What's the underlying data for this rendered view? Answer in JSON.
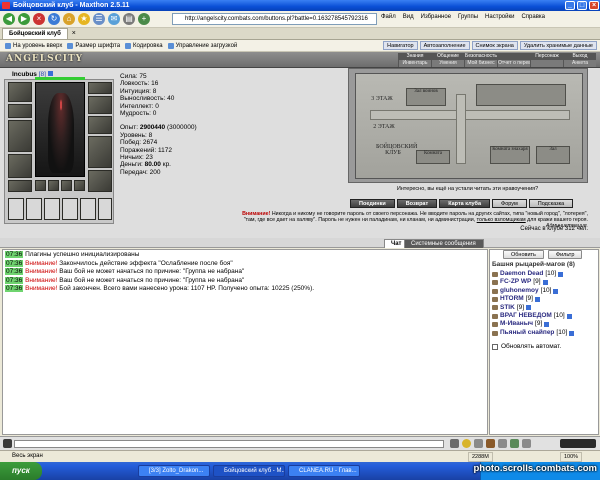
{
  "window": {
    "title": "Бойцовский клуб - Maxthon 2.5.11"
  },
  "browser": {
    "address": "http://angelscity.combats.com/buttons.pl?battle=0.163278545792316",
    "menus": [
      "Файл",
      "Вид",
      "Избранное",
      "Группы",
      "Настройки",
      "Справка"
    ],
    "tabs": [
      {
        "label": "Бойцовский клуб",
        "active": true
      }
    ],
    "toolbar": [
      "На уровень вверх",
      "Размер шрифта",
      "Кодировка",
      "Управление загрузкой"
    ],
    "toolbar_right": [
      "Навигатор",
      "Автозаполнение",
      "Снимок экрана",
      "Удалить хранимые данные"
    ]
  },
  "game": {
    "logo": "ANGELSCITY",
    "menu_top": [
      "Знания",
      "Общение",
      "Безопасность",
      "Персонаж",
      "Выход"
    ],
    "menu_bottom": [
      "Инвентарь",
      "Умения",
      "Мой бизнес",
      "Отчет о переводах",
      "Анкета"
    ],
    "character": {
      "name": "Incubus",
      "level": "[8]",
      "stats": [
        {
          "label": "Сила",
          "value": "75"
        },
        {
          "label": "Ловкость",
          "value": "16"
        },
        {
          "label": "Интуиция",
          "value": "8"
        },
        {
          "label": "Выносливость",
          "value": "40"
        },
        {
          "label": "Интеллект",
          "value": "0"
        },
        {
          "label": "Мудрость",
          "value": "0"
        }
      ],
      "experience_label": "Опыт:",
      "experience": "2900440",
      "experience_next": "(3000000)",
      "level_label": "Уровень:",
      "level_value": "8",
      "wins_label": "Побед:",
      "wins": "2674",
      "losses_label": "Поражений:",
      "losses": "1172",
      "draws_label": "Ничьих:",
      "draws": "23",
      "money_label": "Деньги:",
      "money": "80.00",
      "money_unit": "кр.",
      "transfers_label": "Передач:",
      "transfers": "200"
    },
    "map": {
      "rooms": [
        "3 ЭТАЖ",
        "Зал воинов",
        "2 ЭТАЖ",
        "Комната",
        "БОЙЦОВСКИЙ КЛУБ",
        "Комната знахаря",
        "Зал"
      ],
      "caption": "Интересно, вы ещё на устали читать эти нравоучения?"
    },
    "buttons": [
      "Поединки",
      "Возврат",
      "Карта клуба",
      "Форум",
      "Подсказка"
    ],
    "warning_label": "Внимание!",
    "warning_text": "Никогда и никому не говорите пароль от своего персонажа. Не вводите пароль на других сайтах, типа \"новый город\", \"лотерея\", \"там, где все дает на халяву\". Пароль не нужен ни паладинам, ни кланам, ни администрации,",
    "warning_link": "только взломщикам",
    "warning_tail": "для кражи вашего героя.",
    "warning_sign": "Администрация.",
    "online": "Сейчас в клубе 312 чел."
  },
  "chat": {
    "tabs": [
      "Чат",
      "Системные сообщения"
    ],
    "messages": [
      {
        "time": "07:36",
        "warn": "",
        "text": "Плагины успешно инициализированы"
      },
      {
        "time": "07:36",
        "warn": "Внимание!",
        "text": "Закончилось действие эффекта \"Ослабление после боя\""
      },
      {
        "time": "07:36",
        "warn": "Внимание!",
        "text": "Ваш бой не может начаться по причине: \"Группа не набрана\""
      },
      {
        "time": "07:36",
        "warn": "Внимание!",
        "text": "Ваш бой не может начаться по причине: \"Группа не набрана\""
      },
      {
        "time": "07:36",
        "warn": "Внимание!",
        "text": "Бой закончен. Всего вами нанесено урона: 1107 HP. Получено опыта: 10225 (250%)."
      }
    ]
  },
  "players": {
    "refresh_label": "Обновить",
    "filter_label": "Фильтр",
    "title": "Башня рыцарей-магов (8)",
    "list": [
      {
        "name": "Daemon Dead",
        "level": "[10]"
      },
      {
        "name": "FC-ZP WP",
        "level": "[9]"
      },
      {
        "name": "gluhonemoy",
        "level": "[10]"
      },
      {
        "name": "HTORM",
        "level": "[9]"
      },
      {
        "name": "STIK",
        "level": "[9]"
      },
      {
        "name": "ВРАГ НЕВЕДОМ",
        "level": "[10]"
      },
      {
        "name": "М-Иваныч",
        "level": "[9]"
      },
      {
        "name": "Пьяный снайпер",
        "level": "[10]"
      }
    ],
    "auto_refresh_label": "Обновлять автомат."
  },
  "statusbar": {
    "text": "Весь экран",
    "memory": "2288M",
    "zoom": "100%"
  },
  "taskbar": {
    "start": "пуск",
    "tasks": [
      "[3/3] Zolto_Drakon...",
      "Бойцовский клуб - M...",
      "CLANEA.RU - Глав..."
    ],
    "watermark": "photo.scrolls.combats.com"
  }
}
